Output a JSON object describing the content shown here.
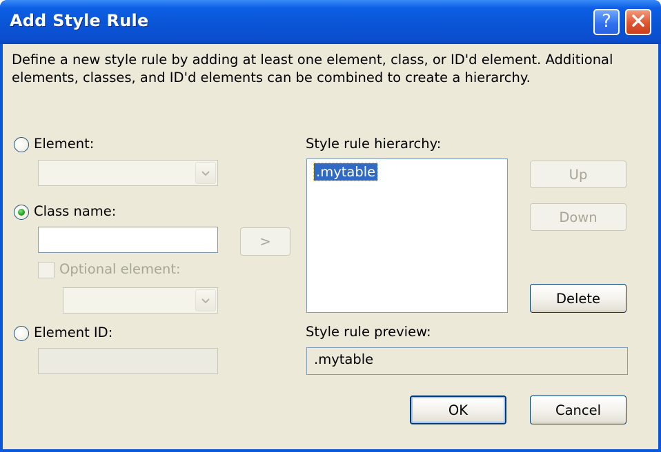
{
  "window": {
    "title": "Add Style Rule",
    "help_icon": "help-icon",
    "close_icon": "close-icon"
  },
  "description": "Define a new style rule by adding at least one element, class, or ID'd element.  Additional elements, classes, and ID'd elements can be combined to create a hierarchy.",
  "element": {
    "label": "Element:",
    "selected": false,
    "value": ""
  },
  "class_name": {
    "label": "Class name:",
    "selected": true,
    "value": "",
    "optional_element_label": "Optional element:",
    "optional_element_checked": false,
    "optional_element_value": ""
  },
  "element_id": {
    "label": "Element ID:",
    "selected": false,
    "value": ""
  },
  "add_button": ">",
  "hierarchy": {
    "label": "Style rule hierarchy:",
    "items": [
      ".mytable"
    ]
  },
  "buttons": {
    "up": "Up",
    "down": "Down",
    "delete": "Delete",
    "ok": "OK",
    "cancel": "Cancel"
  },
  "preview": {
    "label": "Style rule preview:",
    "value": ".mytable"
  },
  "colors": {
    "title_bar": "#0a54d6",
    "dialog_bg": "#ece9d8",
    "selection": "#316ac5",
    "radio_dot": "#21a121"
  }
}
